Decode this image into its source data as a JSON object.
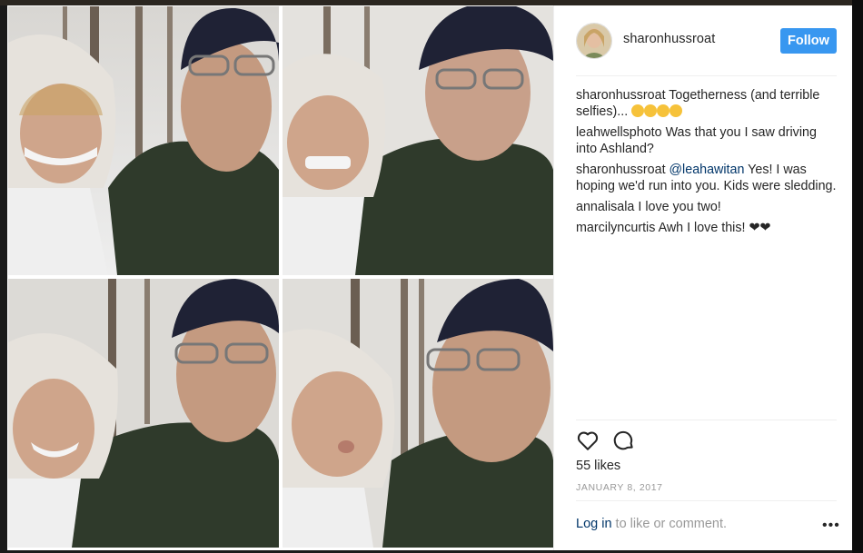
{
  "post": {
    "username": "sharonhussroat",
    "follow_label": "Follow",
    "caption": {
      "user": "sharonhussroat",
      "text": "Togetherness (and terrible selfies)...",
      "emojis": [
        "grinning-face",
        "grimacing-face",
        "grinning-face",
        "kissing-face"
      ]
    },
    "comments": [
      {
        "user": "leahwellsphoto",
        "text": "Was that you I saw driving into Ashland?"
      },
      {
        "user": "sharonhussroat",
        "mention": "@leahawitan",
        "text": "Yes! I was hoping we'd run into you. Kids were sledding."
      },
      {
        "user": "annalisala",
        "text": "I love you two!"
      },
      {
        "user": "marcilyncurtis",
        "text": "Awh I love this!",
        "suffix": "❤❤"
      }
    ],
    "likes": "55 likes",
    "date": "JANUARY 8, 2017",
    "footer": {
      "login": "Log in",
      "text": "to like or comment.",
      "more": "•••"
    }
  },
  "icons": {
    "like": "heart-outline-icon",
    "comment": "comment-bubble-icon",
    "more": "more-options-icon"
  },
  "colors": {
    "follow_button": "#3897f0",
    "link": "#003569",
    "muted": "#999999",
    "text": "#262626"
  }
}
